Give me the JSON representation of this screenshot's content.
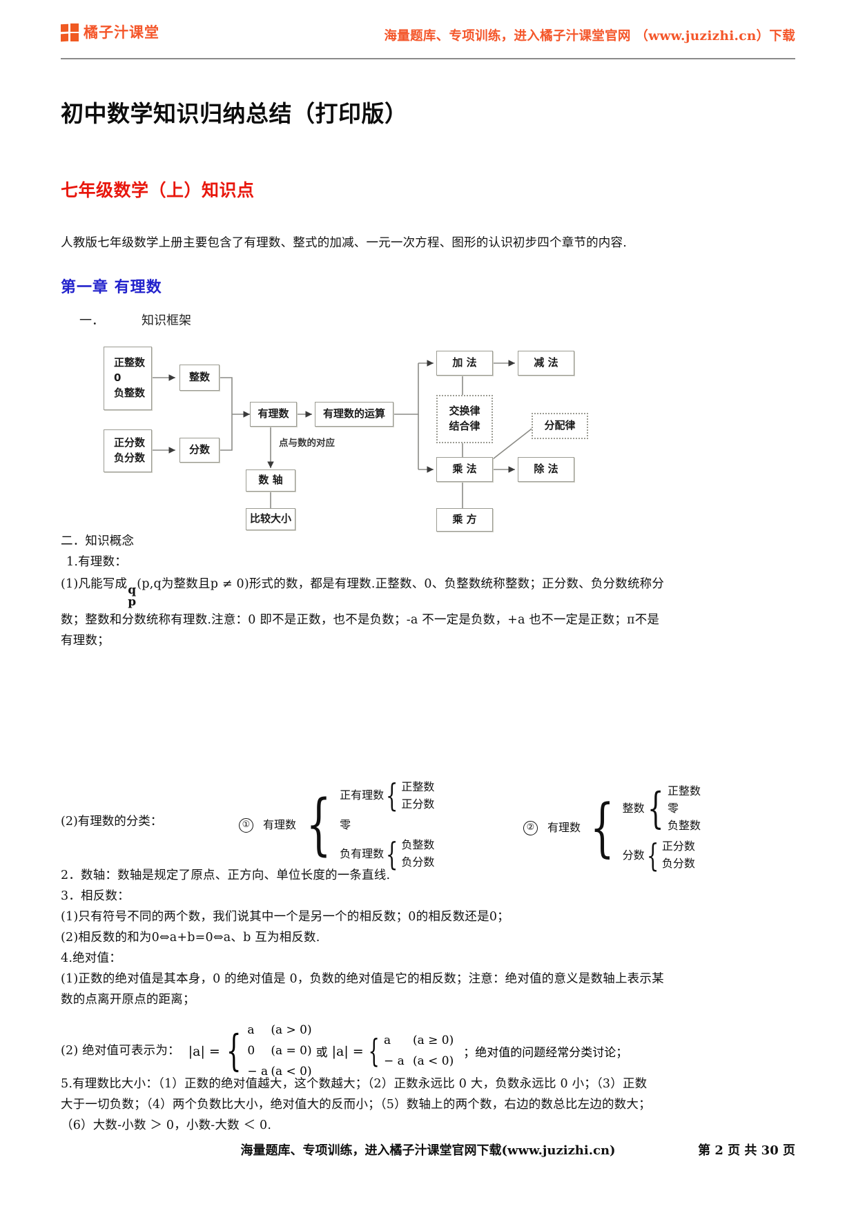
{
  "header": {
    "brand_name": "橘子汁课堂",
    "logo_icon": "four-square-grid-icon",
    "slogan": "海量题库、专项训练，进入橘子汁课堂官网 （www.juzizhi.cn）下载"
  },
  "doc_title": "初中数学知识归纳总结（打印版）",
  "section_title": "七年级数学（上）知识点",
  "intro_para": "人教版七年级数学上册主要包含了有理数、整式的加减、一元一次方程、图形的认识初步四个章节的内容.",
  "chapter_title": "第一章  有理数",
  "frame_label": {
    "num": "一．",
    "text": "知识框架"
  },
  "flowchart": {
    "nodes": {
      "zheng_zhengshu": "正整数",
      "zero": "0",
      "fu_zhengshu": "负整数",
      "zhengshu": "整数",
      "zheng_fenshu": "正分数",
      "fu_fenshu": "负分数",
      "fenshu": "分数",
      "youlishu": "有理数",
      "youlishu_yunsuan": "有理数的运算",
      "shuzhou": "数  轴",
      "bijiao_daxiao": "比较大小",
      "jiafa": "加  法",
      "jianfa": "减  法",
      "chengfa": "乘  法",
      "chufa": "除  法",
      "chengfang": "乘  方",
      "jiaohuanlv": "交换律",
      "jiehelv": "结合律",
      "fenpeilv": "分配律"
    },
    "edge_labels": {
      "dian_yu_shu": "点与数的对应"
    }
  },
  "concepts": {
    "heading2": "二．知识概念",
    "item1_title": "1.有理数：",
    "item1_p1_a": "(1)凡能写成",
    "item1_frac_num": "q",
    "item1_frac_den": "p",
    "item1_p1_b": "(p,q为整数且p ≠ 0)形式的数，都是有理数.正整数、0、负整数统称整数；正分数、负分数统称分",
    "item1_p2": "数；整数和分数统称有理数.注意：0 即不是正数，也不是负数；-a 不一定是负数，+a 也不一定是正数；π不是",
    "item1_p3": "有理数；",
    "item2_lead": "(2)有理数的分类：",
    "classify": {
      "branch1_mark": "①",
      "branch1_root": "有理数",
      "branch1_children": [
        {
          "label": "正有理数",
          "sub": [
            "正整数",
            "正分数"
          ]
        },
        {
          "label": "零",
          "sub": []
        },
        {
          "label": "负有理数",
          "sub": [
            "负整数",
            "负分数"
          ]
        }
      ],
      "branch2_mark": "②",
      "branch2_root": "有理数",
      "branch2_children": [
        {
          "label": "整数",
          "sub": [
            "正整数",
            "零",
            "负整数"
          ]
        },
        {
          "label": "分数",
          "sub": [
            "正分数",
            "负分数"
          ]
        }
      ]
    },
    "item3": "2．数轴：数轴是规定了原点、正方向、单位长度的一条直线.",
    "item4_title": "3．相反数：",
    "item4_p1": "(1)只有符号不同的两个数，我们说其中一个是另一个的相反数；0的相反数还是0；",
    "item4_p2": "(2)相反数的和为0⇔a+b=0⇔a、b 互为相反数.",
    "item5_title": "4.绝对值：",
    "item5_p1": "(1)正数的绝对值是其本身，0 的绝对值是 0，负数的绝对值是它的相反数；注意：绝对值的意义是数轴上表示某",
    "item5_p2": "数的点离开原点的距离；",
    "item6_lead": "(2)  绝对值可表示为：",
    "item6_abs": "|a| =",
    "item6_case1": [
      {
        "val": "a",
        "cond": "(a > 0)"
      },
      {
        "val": "0",
        "cond": "(a = 0)"
      },
      {
        "val": "− a",
        "cond": "(a < 0)"
      }
    ],
    "item6_or": "或",
    "item6_abs2": "|a| =",
    "item6_case2": [
      {
        "val": "a",
        "cond": "(a ≥ 0)"
      },
      {
        "val": "− a",
        "cond": "(a < 0)"
      }
    ],
    "item6_tail": "；绝对值的问题经常分类讨论；",
    "item7_l1": "5.有理数比大小：（1）正数的绝对值越大，这个数越大；（2）正数永远比 0 大，负数永远比 0 小；（3）正数",
    "item7_l2": "大于一切负数；（4）两个负数比大小，绝对值大的反而小；（5）数轴上的两个数，右边的数总比左边的数大；",
    "item7_l3": "（6）大数-小数 ＞ 0，小数-大数 ＜ 0."
  },
  "footer": {
    "center": "海量题库、专项训练，进入橘子汁课堂官网下载(www.juzizhi.cn)",
    "page": "第 2 页 共 30 页"
  },
  "colors": {
    "brand_orange": "#f4562a",
    "section_red": "#e8170d",
    "chapter_blue": "#2222cc",
    "rule_gray": "#8a8a8a",
    "box_border": "#9b9b92"
  }
}
